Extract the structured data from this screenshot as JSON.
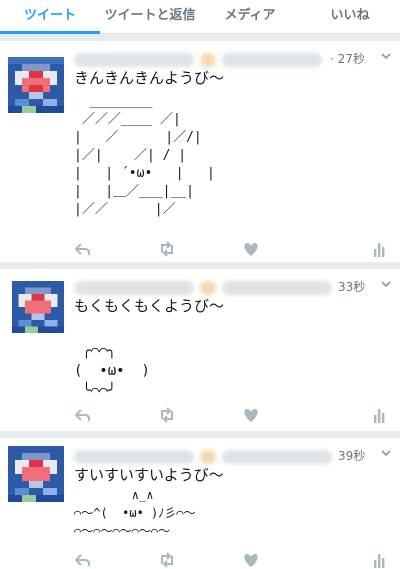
{
  "tabs": [
    "ツイート",
    "ツイートと返信",
    "メディア",
    "いいね"
  ],
  "active_tab": 0,
  "colors": {
    "accent": "#1da1f2",
    "icon": "#aab8c2",
    "divider": "#e6ecf0"
  },
  "tweets": [
    {
      "time": "· 27秒",
      "text": "きんきんきんようび〜",
      "art": "  ________\n ／／／____ ／|\n|   ／      |／/|\n|／|    ／| / |\n|   | ´•ω•   |   |\n|   |＿／___|__|\n|／／      |／"
    },
    {
      "time": "33秒",
      "text": "もくもくもくようび〜",
      "art": " ╭⌒⌒╮\n(  •ω•  )\n ╰⌒⌒╯"
    },
    {
      "time": "39秒",
      "text": "すいすいすいようび〜",
      "art": "        ∧_∧\n⌒〜^(  •ω• )ﾉ彡⌒〜\n⌒〜⌒〜⌒〜⌒〜⌒〜"
    }
  ],
  "action_icons": [
    "reply-icon",
    "retweet-icon",
    "like-icon",
    "analytics-icon"
  ]
}
